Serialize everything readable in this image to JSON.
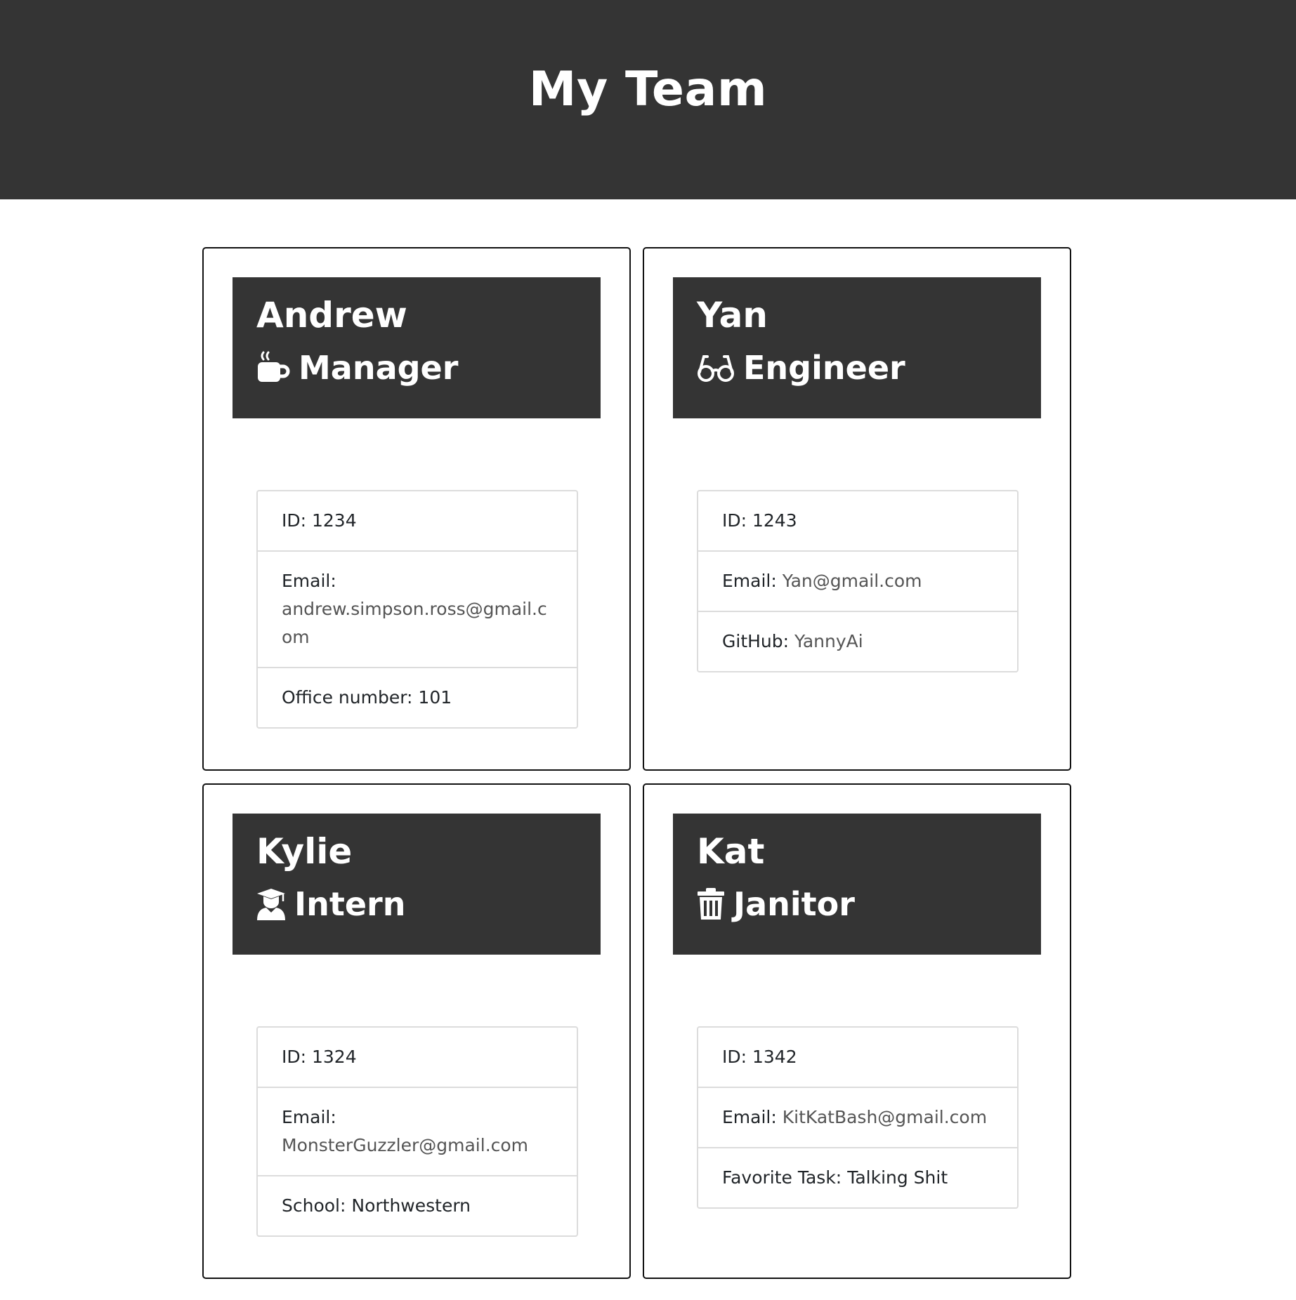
{
  "header": {
    "title": "My Team"
  },
  "employees": [
    {
      "name": "Andrew",
      "role": "Manager",
      "icon": "coffee-icon",
      "id_label": "ID: ",
      "id": "1234",
      "email_label": "Email: ",
      "email": "andrew.simpson.ross@gmail.com",
      "extra_label": "Office number: ",
      "extra": "101"
    },
    {
      "name": "Yan",
      "role": "Engineer",
      "icon": "glasses-icon",
      "id_label": "ID: ",
      "id": "1243",
      "email_label": "Email: ",
      "email": "Yan@gmail.com",
      "extra_label": "GitHub: ",
      "extra": "YannyAi"
    },
    {
      "name": "Kylie",
      "role": "Intern",
      "icon": "graduate-icon",
      "id_label": "ID: ",
      "id": "1324",
      "email_label": "Email: ",
      "email": "MonsterGuzzler@gmail.com",
      "extra_label": "School: ",
      "extra": "Northwestern"
    },
    {
      "name": "Kat",
      "role": "Janitor",
      "icon": "trash-icon",
      "id_label": "ID: ",
      "id": "1342",
      "email_label": "Email: ",
      "email": "KitKatBash@gmail.com",
      "extra_label": "Favorite Task: ",
      "extra": "Talking Shit"
    }
  ],
  "colors": {
    "banner": "#343434",
    "link": "#555555",
    "border": "#dcdcdc"
  }
}
